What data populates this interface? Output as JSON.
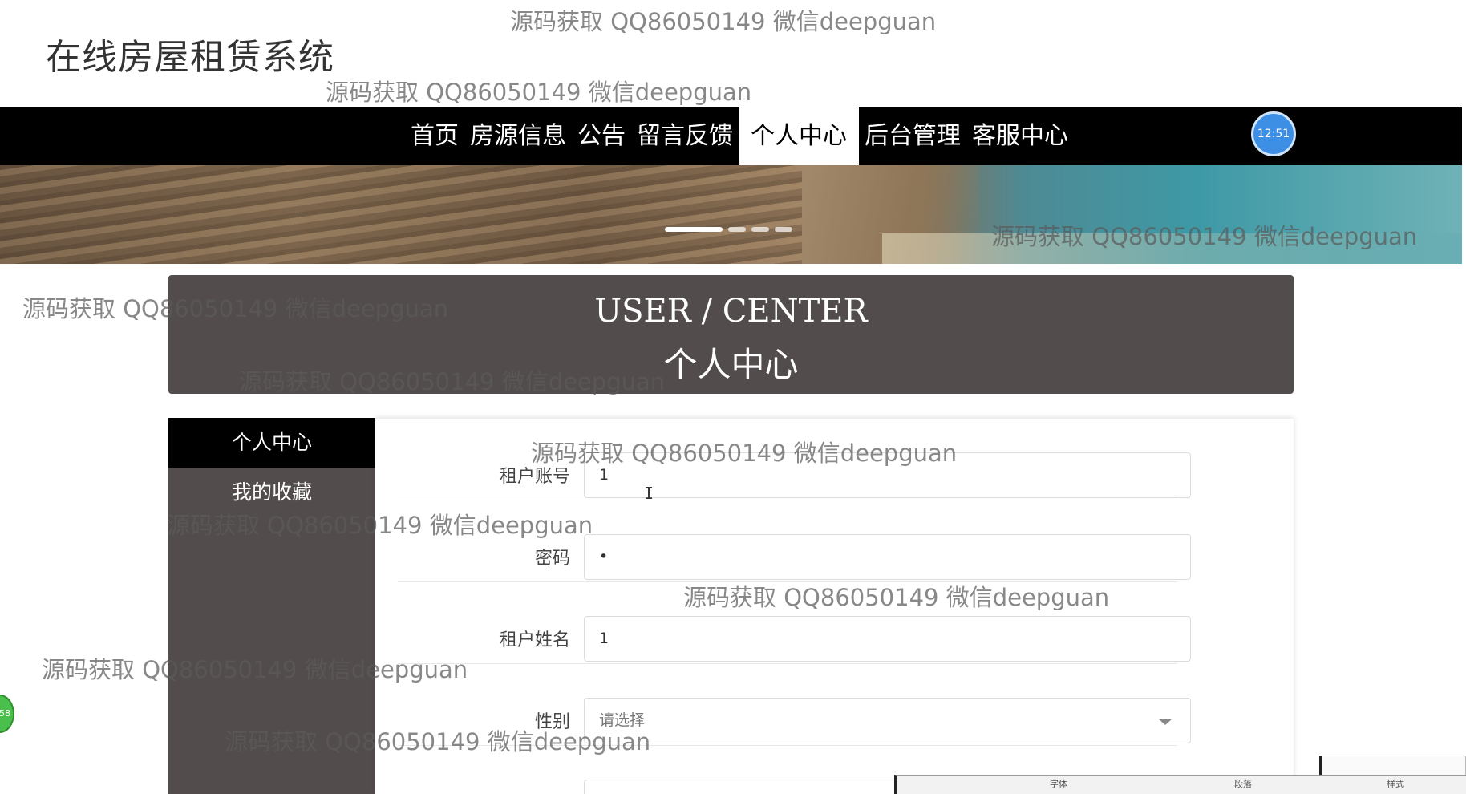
{
  "site": {
    "title": "在线房屋租赁系统"
  },
  "nav": {
    "items": [
      "首页",
      "房源信息",
      "公告",
      "留言反馈",
      "个人中心",
      "后台管理",
      "客服中心"
    ],
    "active": "个人中心"
  },
  "clock": {
    "time": "12:51"
  },
  "banner": {
    "slide_count": 4,
    "active_slide": 1
  },
  "page_header": {
    "en": "USER / CENTER",
    "zh": "个人中心"
  },
  "sidebar": {
    "items": [
      "个人中心",
      "我的收藏"
    ],
    "active": "个人中心"
  },
  "form": {
    "fields": [
      {
        "label": "租户账号",
        "value": "1"
      },
      {
        "label": "密码",
        "value": "•"
      },
      {
        "label": "租户姓名",
        "value": "1"
      },
      {
        "label": "性别",
        "value": "请选择"
      }
    ]
  },
  "floater": {
    "text": "58"
  },
  "taskbar": {
    "segments": [
      "字体",
      "段落",
      "样式"
    ]
  },
  "watermark": "源码获取 QQ86050149 微信deepguan",
  "colors": {
    "navbar": "#000000",
    "header_bg": "#534c4c",
    "sidebar_bg": "#534c4c",
    "clock": "#3d8fe6"
  }
}
